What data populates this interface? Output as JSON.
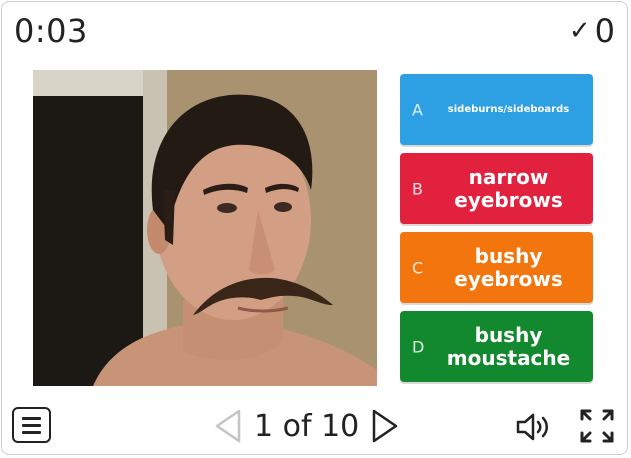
{
  "header": {
    "timer": "0:03",
    "score_icon": "checkmark-icon",
    "score": "0"
  },
  "image": {
    "subject": "man with bushy moustache"
  },
  "answers": [
    {
      "letter": "A",
      "text": "sideburns/sideboards",
      "color": "#2d9fe3"
    },
    {
      "letter": "B",
      "text": "narrow eyebrows",
      "color": "#e2213f"
    },
    {
      "letter": "C",
      "text": "bushy eyebrows",
      "color": "#f2750d"
    },
    {
      "letter": "D",
      "text": "bushy moustache",
      "color": "#13892f"
    }
  ],
  "footer": {
    "counter": "1 of 10",
    "menu_icon": "menu-icon",
    "prev_icon": "triangle-left-icon",
    "next_icon": "triangle-right-icon",
    "sound_icon": "speaker-icon",
    "fullscreen_icon": "fullscreen-icon"
  }
}
